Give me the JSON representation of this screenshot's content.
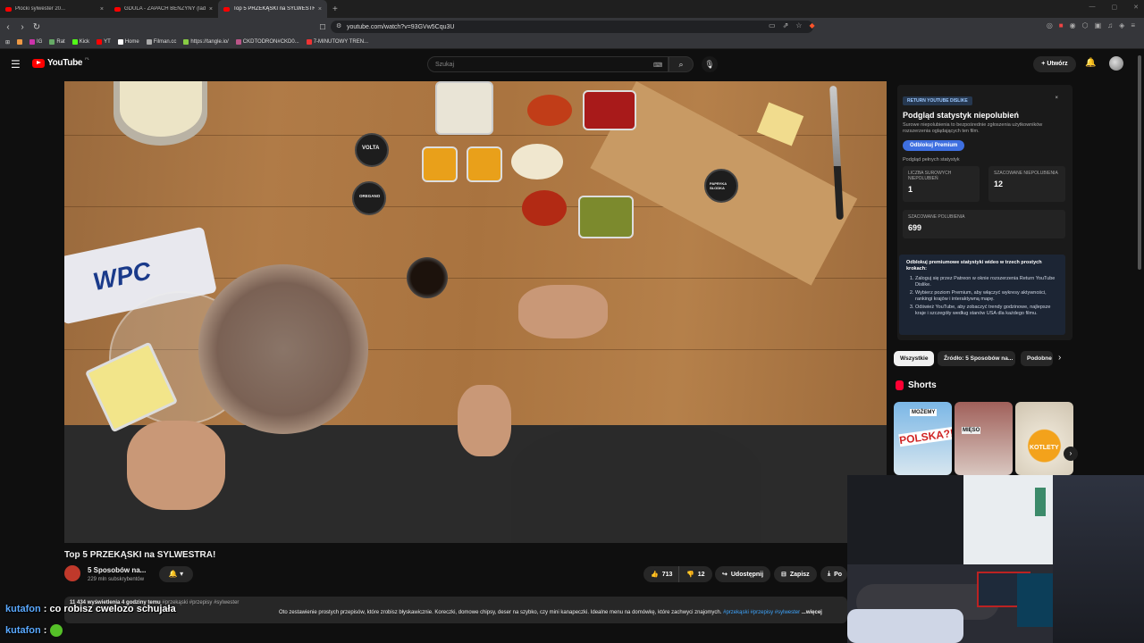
{
  "browser": {
    "tabs": [
      {
        "title": "Plocki sylwester 20...",
        "active": false
      },
      {
        "title": "GDULA - ZAPACH BENZYNY (ladne ...",
        "active": false
      },
      {
        "title": "Top 5 PRZEKĄSKI na SYLWESTRA...",
        "active": true
      }
    ],
    "new_tab": "+",
    "url": "youtube.com/watch?v=93GVw5Cqu3U",
    "bookmarks": [
      "IG",
      "Rat",
      "Kick",
      "YT",
      "Home",
      "Filman.cc",
      "https://tangle.io/",
      "CKDTODRON#CKD0...",
      "7-MINUTOWY TREN..."
    ]
  },
  "youtube": {
    "logo_text": "YouTube",
    "region": "PL",
    "search_placeholder": "Szukaj",
    "create_label": "Utwórz"
  },
  "video": {
    "title": "Top 5 PRZEKĄSKI na SYLWESTRA!",
    "channel_name": "5 Sposobów na...",
    "channel_subs": "229 mln subskrybentów",
    "likes": "713",
    "dislikes": "12",
    "share_label": "Udostępnij",
    "save_label": "Zapisz",
    "download_label": "Po",
    "views_line": "11 434 wyświetlenia  4 godziny temu",
    "hashtags_line": "#przekąski #przepisy #sylwester",
    "description": "Oto zestawienie prostych przepisów, które zrobisz błyskawicznie. Koreczki, domowe chipsy, deser na szybko, czy mini kanapeczki. Idealne menu na domówkę, które zachwyci znajomych.",
    "desc_tags": "#przekąski  #przepisy  #sylwester",
    "desc_more": "...więcej",
    "jar_labels": [
      "VOLTA",
      "OREGANO",
      "PAPRYKA SŁODKA"
    ],
    "bag_label": "WPC"
  },
  "ryd": {
    "badge": "RETURN YOUTUBE DISLIKE",
    "close": "×",
    "heading": "Podgląd statystyk niepolubień",
    "desc": "Surowe niepolubienia to bezpośrednie zgłoszenia użytkowników rozszerzenia oglądających ten film.",
    "button": "Odblokuj Premium",
    "link": "Podgląd pełnych statystyk",
    "raw_label": "LICZBA SUROWYCH NIEPOLUBIEŃ",
    "raw_value": "1",
    "est_dislikes_label": "SZACOWANE NIEPOLUBIENIA",
    "est_dislikes_value": "12",
    "est_likes_label": "SZACOWANE POLUBIENIA",
    "est_likes_value": "699",
    "info_title": "Odblokuj premiumowe statystyki wideo w trzech prostych krokach:",
    "steps": [
      "Zaloguj się przez Patreon w oknie rozszerzenia Return YouTube Dislike.",
      "Wybierz poziom Premium, aby włączyć wykresy aktywności, rankingi krajów i interaktywną mapę.",
      "Odśwież YouTube, aby zobaczyć trendy godzinowe, najlepsze kraje i szczegóły według stanów USA dla każdego filmu."
    ]
  },
  "chips": [
    "Wszystkie",
    "Źródło: 5 Sposobów na...",
    "Podobne"
  ],
  "shorts": {
    "heading": "Shorts",
    "items": [
      {
        "label": "POLSKA?!",
        "top": "MOŻEMY"
      },
      {
        "label": "MIĘSO",
        "top": ""
      },
      {
        "label": "KOTLETY",
        "top": ""
      }
    ]
  },
  "chat": [
    {
      "user": "kutafon",
      "message": "co robisz cwelozo schujała"
    },
    {
      "user": "kutafon",
      "message": ""
    }
  ],
  "colors": {
    "brand_red": "#ff0000",
    "link_blue": "#3ea6ff",
    "ryd_button": "#3e6fe0"
  }
}
